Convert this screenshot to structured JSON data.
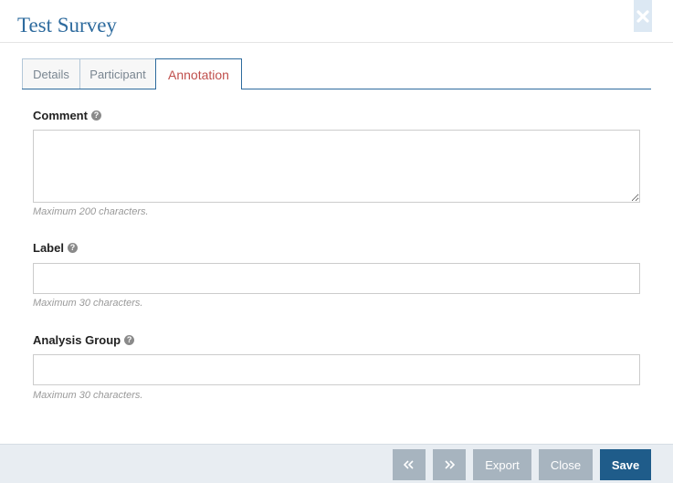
{
  "dialog": {
    "title": "Test Survey",
    "close_icon": "close-icon"
  },
  "tabs": [
    {
      "label": "Details",
      "active": false
    },
    {
      "label": "Participant",
      "active": false
    },
    {
      "label": "Annotation",
      "active": true
    }
  ],
  "form": {
    "comment": {
      "label": "Comment",
      "value": "",
      "hint": "Maximum 200 characters."
    },
    "label_field": {
      "label": "Label",
      "value": "",
      "hint": "Maximum 30 characters."
    },
    "analysis_group": {
      "label": "Analysis Group",
      "value": "",
      "hint": "Maximum 30 characters."
    },
    "help_glyph": "?"
  },
  "footer": {
    "prev_icon": "double-chevron-left-icon",
    "next_icon": "double-chevron-right-icon",
    "export_label": "Export",
    "close_label": "Close",
    "save_label": "Save"
  },
  "colors": {
    "brand": "#2e6b9e",
    "active_tab_text": "#c0504d",
    "primary_button": "#1f5c8a",
    "secondary_button": "#a7b4bf"
  }
}
